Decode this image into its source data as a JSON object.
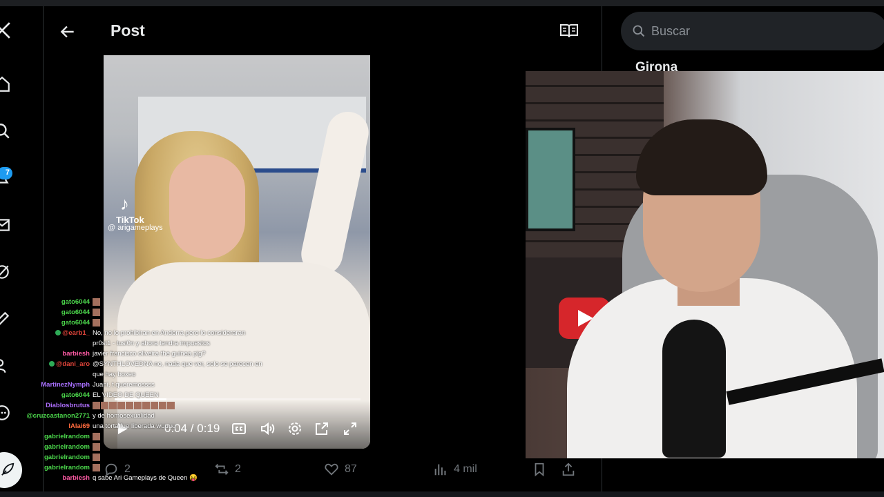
{
  "header": {
    "title": "Post"
  },
  "notifications": {
    "count": "7"
  },
  "video": {
    "tiktok_label": "TikTok",
    "tiktok_handle": "@ arigameplays",
    "time": "0:04 / 0:19",
    "progress_fraction": 0.21
  },
  "actions": {
    "replies": "2",
    "reposts": "2",
    "likes": "87",
    "views": "4 mil"
  },
  "search": {
    "placeholder": "Buscar"
  },
  "sidebar": {
    "trend_title": "Girona"
  },
  "chat": [
    {
      "user": "gato6044",
      "color": "#4cd84c",
      "emotes": 1,
      "msg": ""
    },
    {
      "user": "gato6044",
      "color": "#4cd84c",
      "emotes": 1,
      "msg": ""
    },
    {
      "user": "gato6044",
      "color": "#4cd84c",
      "emotes": 1,
      "msg": ""
    },
    {
      "user": "@earb1_",
      "color": "#e0443a",
      "mod": true,
      "msg": "No, no lo prohibiran en Andorra pero lo consideraran"
    },
    {
      "user": "",
      "color": "#ffffff",
      "msg": "pr0st1 - tusi0n y ahora tendra impuestos"
    },
    {
      "user": "barbiesh",
      "color": "#ff5aa5",
      "msg": "javier francisco oliveira the guinea pig?"
    },
    {
      "user": "@dani_aro",
      "color": "#e0443a",
      "mod": true,
      "msg": "@SYNTHLOVEDNA no, nada que ver, solo se parecen en"
    },
    {
      "user": "",
      "color": "#ffffff",
      "msg": "que hay boxeo"
    },
    {
      "user": "MartinezNymph",
      "color": "#a970ff",
      "msg": "Juani, t queremossss"
    },
    {
      "user": "gato6044",
      "color": "#4cd84c",
      "msg": "EL VIDEO DE QUEEN"
    },
    {
      "user": "Diablosbrutus",
      "color": "#b070ff",
      "emotes": 10,
      "msg": ""
    },
    {
      "user": "@cruzcastanon2771",
      "color": "#4cd84c",
      "msg": "y de homosexualidad"
    },
    {
      "user": "lAlai69",
      "color": "#ff6a3d",
      "msg": "una torta fue liberada wuuuu"
    },
    {
      "user": "gabrielrandom",
      "color": "#4cd84c",
      "emotes": 1,
      "msg": ""
    },
    {
      "user": "gabrielrandom",
      "color": "#4cd84c",
      "emotes": 1,
      "msg": ""
    },
    {
      "user": "gabrielrandom",
      "color": "#4cd84c",
      "emotes": 1,
      "msg": ""
    },
    {
      "user": "gabrielrandom",
      "color": "#4cd84c",
      "emotes": 1,
      "msg": ""
    },
    {
      "user": "barbiesh",
      "color": "#ff5aa5",
      "msg": "q sabe Ari Gameplays de Queen 😝"
    }
  ]
}
